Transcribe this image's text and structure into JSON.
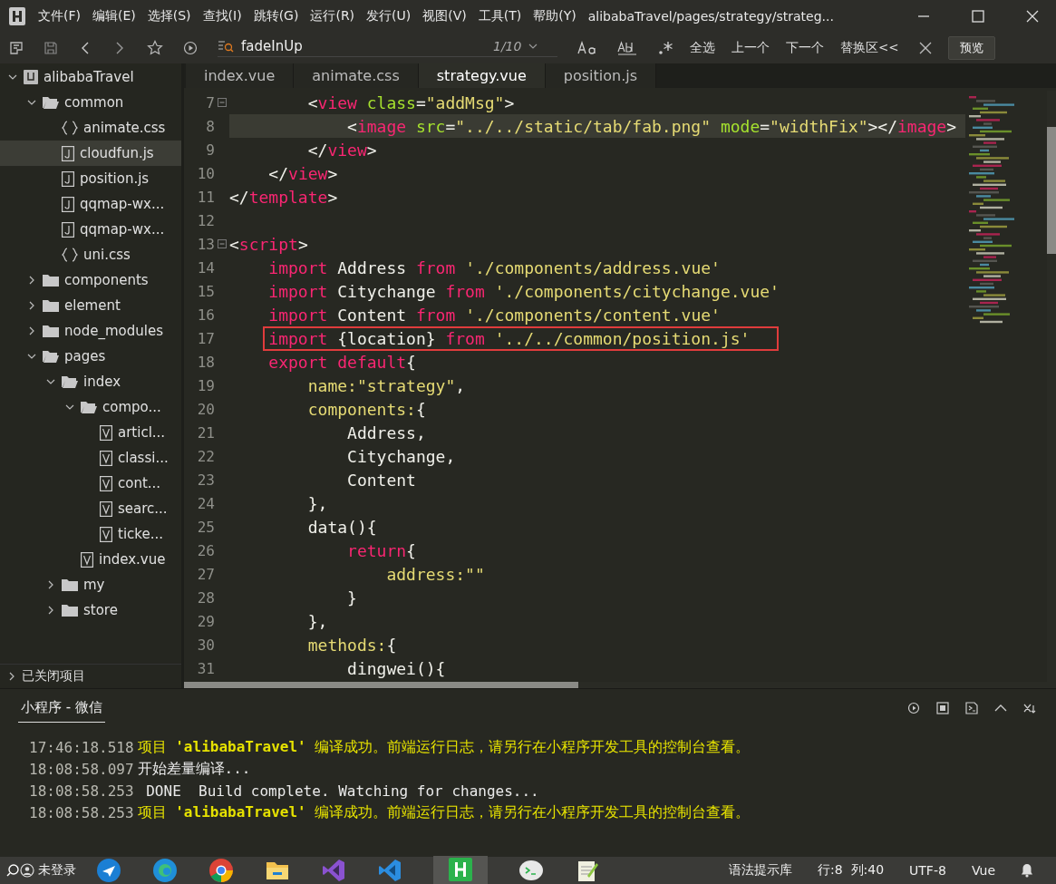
{
  "window": {
    "title": "alibabaTravel/pages/strategy/strateg..."
  },
  "menu": [
    "文件(F)",
    "编辑(E)",
    "选择(S)",
    "查找(I)",
    "跳转(G)",
    "运行(R)",
    "发行(U)",
    "视图(V)",
    "工具(T)",
    "帮助(Y)"
  ],
  "find_bar": {
    "value": "fadeInUp",
    "match_count": "1/10",
    "actions": [
      "全选",
      "上一个",
      "下一个",
      "替换区<<"
    ],
    "preview_button": "预览"
  },
  "tabs": [
    {
      "label": "index.vue",
      "selected": false
    },
    {
      "label": "animate.css",
      "selected": false
    },
    {
      "label": "strategy.vue",
      "selected": true
    },
    {
      "label": "position.js",
      "selected": false
    }
  ],
  "sidebar": {
    "tree": [
      {
        "name": "alibabaTravel",
        "kind": "project",
        "selected": false,
        "expanded": true,
        "children": [
          {
            "name": "common",
            "kind": "folder",
            "selected": false,
            "expanded": true,
            "children": [
              {
                "name": "animate.css",
                "kind": "css",
                "selected": false
              },
              {
                "name": "cloudfun.js",
                "kind": "js",
                "selected": true
              },
              {
                "name": "position.js",
                "kind": "js",
                "selected": false
              },
              {
                "name": "qqmap-wx...",
                "kind": "js",
                "selected": false
              },
              {
                "name": "qqmap-wx...",
                "kind": "js",
                "selected": false
              },
              {
                "name": "uni.css",
                "kind": "css",
                "selected": false
              }
            ]
          },
          {
            "name": "components",
            "kind": "folder",
            "selected": false,
            "expanded": false
          },
          {
            "name": "element",
            "kind": "folder",
            "selected": false,
            "expanded": false
          },
          {
            "name": "node_modules",
            "kind": "folder",
            "selected": false,
            "expanded": false
          },
          {
            "name": "pages",
            "kind": "folder",
            "selected": false,
            "expanded": true,
            "children": [
              {
                "name": "index",
                "kind": "folder",
                "selected": false,
                "expanded": true,
                "children": [
                  {
                    "name": "compo...",
                    "kind": "folder",
                    "selected": false,
                    "expanded": true,
                    "children": [
                      {
                        "name": "articl...",
                        "kind": "vue",
                        "selected": false
                      },
                      {
                        "name": "classi...",
                        "kind": "vue",
                        "selected": false
                      },
                      {
                        "name": "cont...",
                        "kind": "vue",
                        "selected": false
                      },
                      {
                        "name": "searc...",
                        "kind": "vue",
                        "selected": false
                      },
                      {
                        "name": "ticke...",
                        "kind": "vue",
                        "selected": false
                      }
                    ]
                  },
                  {
                    "name": "index.vue",
                    "kind": "vue",
                    "selected": false
                  }
                ]
              },
              {
                "name": "my",
                "kind": "folder",
                "selected": false,
                "expanded": false
              },
              {
                "name": "store",
                "kind": "folder",
                "selected": false,
                "expanded": false
              }
            ]
          }
        ]
      }
    ],
    "closed_projects": "已关闭项目"
  },
  "editor": {
    "lines": [
      {
        "num": "7",
        "foldable": true,
        "current": false,
        "highlighted": false,
        "tokens": [
          {
            "kind": "plain",
            "text": "        <"
          },
          {
            "kind": "tag",
            "text": "view "
          },
          {
            "kind": "attr",
            "text": "class"
          },
          {
            "kind": "plain",
            "text": "="
          },
          {
            "kind": "string",
            "text": "\"addMsg\""
          },
          {
            "kind": "plain",
            "text": ">"
          }
        ]
      },
      {
        "num": "8",
        "foldable": false,
        "current": true,
        "highlighted": false,
        "tokens": [
          {
            "kind": "plain",
            "text": "            <"
          },
          {
            "kind": "tag",
            "text": "image "
          },
          {
            "kind": "attr",
            "text": "src"
          },
          {
            "kind": "plain",
            "text": "="
          },
          {
            "kind": "string",
            "text": "\"../../static/tab/fab.png\" "
          },
          {
            "kind": "attr",
            "text": "mode"
          },
          {
            "kind": "plain",
            "text": "="
          },
          {
            "kind": "string",
            "text": "\"widthFix\""
          },
          {
            "kind": "plain",
            "text": "></"
          },
          {
            "kind": "tag",
            "text": "image"
          },
          {
            "kind": "plain",
            "text": ">"
          }
        ]
      },
      {
        "num": "9",
        "foldable": false,
        "current": false,
        "highlighted": false,
        "tokens": [
          {
            "kind": "plain",
            "text": "        </"
          },
          {
            "kind": "tag",
            "text": "view"
          },
          {
            "kind": "plain",
            "text": ">"
          }
        ]
      },
      {
        "num": "10",
        "foldable": false,
        "current": false,
        "highlighted": false,
        "tokens": [
          {
            "kind": "plain",
            "text": "    </"
          },
          {
            "kind": "tag",
            "text": "view"
          },
          {
            "kind": "plain",
            "text": ">"
          }
        ]
      },
      {
        "num": "11",
        "foldable": false,
        "current": false,
        "highlighted": false,
        "tokens": [
          {
            "kind": "plain",
            "text": "</"
          },
          {
            "kind": "tag",
            "text": "template"
          },
          {
            "kind": "plain",
            "text": ">"
          }
        ]
      },
      {
        "num": "12",
        "foldable": false,
        "current": false,
        "highlighted": false
      },
      {
        "num": "13",
        "foldable": true,
        "current": false,
        "highlighted": false,
        "tokens": [
          {
            "kind": "plain",
            "text": "<"
          },
          {
            "kind": "tag",
            "text": "script"
          },
          {
            "kind": "plain",
            "text": ">"
          }
        ]
      },
      {
        "num": "14",
        "foldable": false,
        "current": false,
        "highlighted": false,
        "tokens": [
          {
            "kind": "keyword",
            "text": "    import"
          },
          {
            "kind": "plain",
            "text": " Address "
          },
          {
            "kind": "keyword",
            "text": "from"
          },
          {
            "kind": "string",
            "text": " './components/address.vue'"
          }
        ]
      },
      {
        "num": "15",
        "foldable": false,
        "current": false,
        "highlighted": false,
        "tokens": [
          {
            "kind": "keyword",
            "text": "    import"
          },
          {
            "kind": "plain",
            "text": " Citychange "
          },
          {
            "kind": "keyword",
            "text": "from"
          },
          {
            "kind": "string",
            "text": " './components/citychange.vue'"
          }
        ]
      },
      {
        "num": "16",
        "foldable": false,
        "current": false,
        "highlighted": false,
        "tokens": [
          {
            "kind": "keyword",
            "text": "    import"
          },
          {
            "kind": "plain",
            "text": " Content "
          },
          {
            "kind": "keyword",
            "text": "from"
          },
          {
            "kind": "string",
            "text": " './components/content.vue'"
          }
        ]
      },
      {
        "num": "17",
        "foldable": false,
        "current": false,
        "highlighted": true,
        "tokens": [
          {
            "kind": "keyword",
            "text": "    import"
          },
          {
            "kind": "plain",
            "text": " {location} "
          },
          {
            "kind": "keyword",
            "text": "from"
          },
          {
            "kind": "string",
            "text": " '../../common/position.js'"
          }
        ]
      },
      {
        "num": "18",
        "foldable": false,
        "current": false,
        "highlighted": false,
        "tokens": [
          {
            "kind": "keyword",
            "text": "    export default"
          },
          {
            "kind": "plain",
            "text": "{"
          }
        ]
      },
      {
        "num": "19",
        "foldable": false,
        "current": false,
        "highlighted": false,
        "tokens": [
          {
            "kind": "prop",
            "text": "        name:"
          },
          {
            "kind": "string",
            "text": "\"strategy\""
          },
          {
            "kind": "plain",
            "text": ","
          }
        ]
      },
      {
        "num": "20",
        "foldable": false,
        "current": false,
        "highlighted": false,
        "tokens": [
          {
            "kind": "prop",
            "text": "        components:"
          },
          {
            "kind": "plain",
            "text": "{"
          }
        ]
      },
      {
        "num": "21",
        "foldable": false,
        "current": false,
        "highlighted": false,
        "tokens": [
          {
            "kind": "plain",
            "text": "            Address,"
          }
        ]
      },
      {
        "num": "22",
        "foldable": false,
        "current": false,
        "highlighted": false,
        "tokens": [
          {
            "kind": "plain",
            "text": "            Citychange,"
          }
        ]
      },
      {
        "num": "23",
        "foldable": false,
        "current": false,
        "highlighted": false,
        "tokens": [
          {
            "kind": "plain",
            "text": "            Content"
          }
        ]
      },
      {
        "num": "24",
        "foldable": false,
        "current": false,
        "highlighted": false,
        "tokens": [
          {
            "kind": "plain",
            "text": "        },"
          }
        ]
      },
      {
        "num": "25",
        "foldable": false,
        "current": false,
        "highlighted": false,
        "tokens": [
          {
            "kind": "plain",
            "text": "        data(){"
          }
        ]
      },
      {
        "num": "26",
        "foldable": false,
        "current": false,
        "highlighted": false,
        "tokens": [
          {
            "kind": "keyword",
            "text": "            return"
          },
          {
            "kind": "plain",
            "text": "{"
          }
        ]
      },
      {
        "num": "27",
        "foldable": false,
        "current": false,
        "highlighted": false,
        "tokens": [
          {
            "kind": "prop",
            "text": "                address:"
          },
          {
            "kind": "string",
            "text": "\"\""
          }
        ]
      },
      {
        "num": "28",
        "foldable": false,
        "current": false,
        "highlighted": false,
        "tokens": [
          {
            "kind": "plain",
            "text": "            }"
          }
        ]
      },
      {
        "num": "29",
        "foldable": false,
        "current": false,
        "highlighted": false,
        "tokens": [
          {
            "kind": "plain",
            "text": "        },"
          }
        ]
      },
      {
        "num": "30",
        "foldable": false,
        "current": false,
        "highlighted": false,
        "tokens": [
          {
            "kind": "prop",
            "text": "        methods:"
          },
          {
            "kind": "plain",
            "text": "{"
          }
        ]
      },
      {
        "num": "31",
        "foldable": false,
        "current": false,
        "highlighted": false,
        "tokens": [
          {
            "kind": "plain",
            "text": "            dingwei(){"
          }
        ]
      }
    ]
  },
  "console": {
    "tab": "小程序 - 微信",
    "lines": [
      {
        "time": "17:46:18.518",
        "kind": "success",
        "message": "项目 **'alibabaTravel'** 编译成功。前端运行日志，请另行在小程序开发工具的控制台查看。"
      },
      {
        "time": "18:08:58.097",
        "kind": "info",
        "message": "开始差量编译..."
      },
      {
        "time": "18:08:58.253",
        "kind": "info",
        "message": " DONE  Build complete. Watching for changes..."
      },
      {
        "time": "18:08:58.253",
        "kind": "success",
        "message": "项目 **'alibabaTravel'** 编译成功。前端运行日志，请另行在小程序开发工具的控制台查看。"
      }
    ]
  },
  "status_bar": {
    "account": "未登录",
    "items": [
      "语法提示库",
      "行:8  列:40",
      "UTF-8",
      "Vue"
    ]
  }
}
